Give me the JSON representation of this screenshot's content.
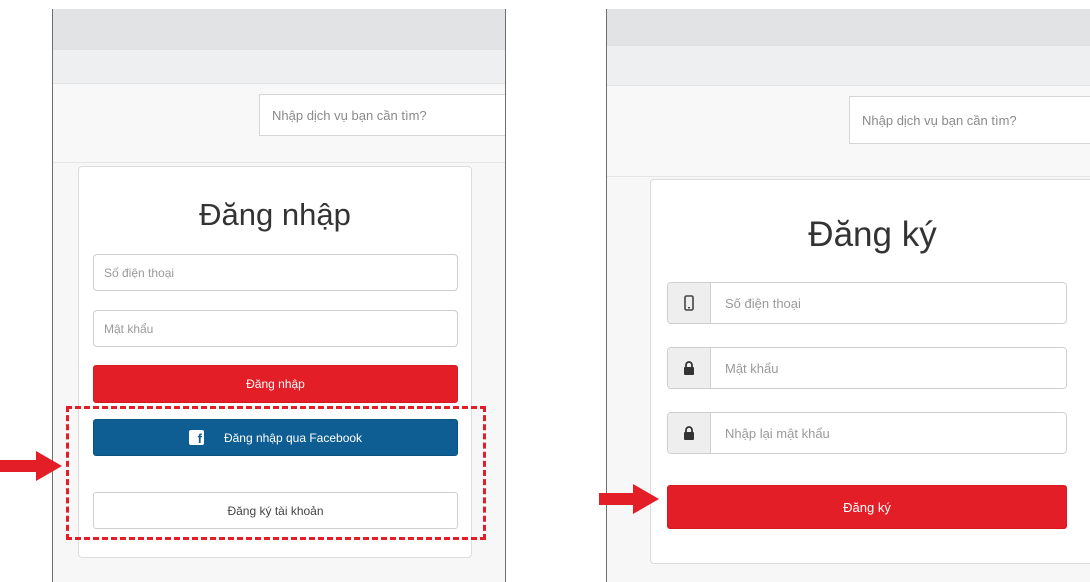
{
  "accent_red": "#e31e26",
  "facebook_blue": "#0e5d93",
  "login_panel": {
    "search_placeholder": "Nhập dịch vụ bạn cần tìm?",
    "title": "Đăng nhập",
    "phone_placeholder": "Số điện thoại",
    "password_placeholder": "Mật khẩu",
    "login_button": "Đăng nhập",
    "facebook_button": "Đăng nhập qua Facebook",
    "facebook_icon": "facebook-icon",
    "register_button": "Đăng ký tài khoản"
  },
  "register_panel": {
    "search_placeholder": "Nhập dịch vụ bạn cần tìm?",
    "title": "Đăng ký",
    "phone_placeholder": "Số điện thoại",
    "phone_icon": "mobile-phone-icon",
    "password_placeholder": "Mật khẩu",
    "password_icon": "lock-icon",
    "confirm_password_placeholder": "Nhập lại mật khẩu",
    "confirm_password_icon": "lock-icon",
    "register_button": "Đăng ký"
  },
  "annotations": {
    "arrow_icon": "red-arrow-icon",
    "highlight": "dashed-highlight-box"
  }
}
